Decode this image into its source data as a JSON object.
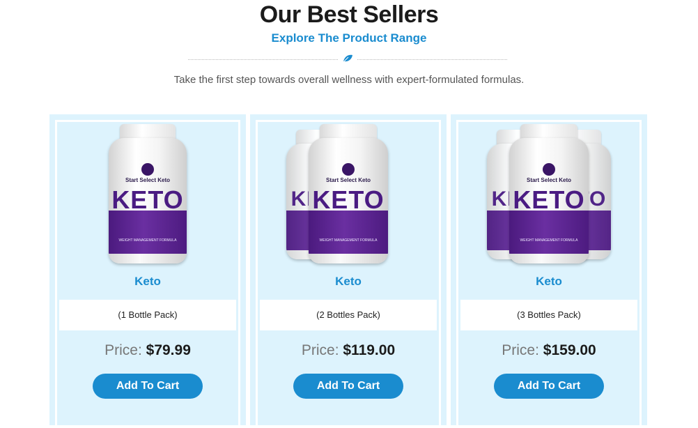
{
  "section": {
    "title": "Our Best Sellers",
    "subtitle": "Explore The Product Range",
    "tagline": "Take the first step towards overall wellness with expert-formulated formulas.",
    "divider_icon": "leaf-icon"
  },
  "colors": {
    "accent": "#1a8ccf",
    "card_bg": "#ddf3fd",
    "purple": "#4a1b82",
    "heading": "#1b1b1b"
  },
  "bottle_label": {
    "brand": "Start Select Keto",
    "word": "KETO",
    "tagline": "WEIGHT MANAGEMENT FORMULA"
  },
  "products": [
    {
      "name": "Keto",
      "pack": "(1 Bottle Pack)",
      "price_label": "Price:",
      "price": "$79.99",
      "button": "Add To Cart"
    },
    {
      "name": "Keto",
      "pack": "(2 Bottles Pack)",
      "price_label": "Price:",
      "price": "$119.00",
      "button": "Add To Cart"
    },
    {
      "name": "Keto",
      "pack": "(3 Bottles Pack)",
      "price_label": "Price:",
      "price": "$159.00",
      "button": "Add To Cart"
    }
  ]
}
